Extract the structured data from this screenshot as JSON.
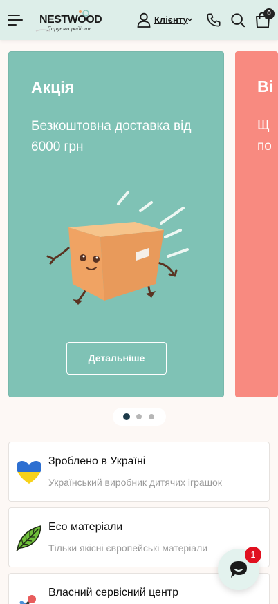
{
  "header": {
    "logo_text": "NESTWOOD",
    "logo_tagline": "Даруємо радість",
    "client_label": "Клієнту",
    "cart_count": "0"
  },
  "slides": [
    {
      "title": "Акція",
      "text": "Безкоштовна доставка від 6000 грн",
      "button_label": "Детальніше",
      "background": "#7fc2b5"
    },
    {
      "title_partial": "Ві",
      "text_partial_line1": "Щ",
      "text_partial_line2": "по",
      "background": "#f88a80"
    }
  ],
  "carousel": {
    "active_index": 0,
    "total": 3
  },
  "features": [
    {
      "icon": "ukraine-heart-icon",
      "title": "Зроблено в Україні",
      "subtitle": "Український виробник дитячих іграшок"
    },
    {
      "icon": "leaf-icon",
      "title": "Eco матеріали",
      "subtitle": "Тільки якісні європейські матеріали"
    },
    {
      "icon": "tools-icon",
      "title": "Власний сервісний центр",
      "subtitle": ""
    }
  ],
  "chat": {
    "unread_count": "1"
  },
  "colors": {
    "header_bg": "#ddeee9",
    "slide_teal": "#7fc2b5",
    "slide_coral": "#f88a80",
    "dot_active": "#1d3b4a",
    "chat_badge": "#e0101f"
  }
}
